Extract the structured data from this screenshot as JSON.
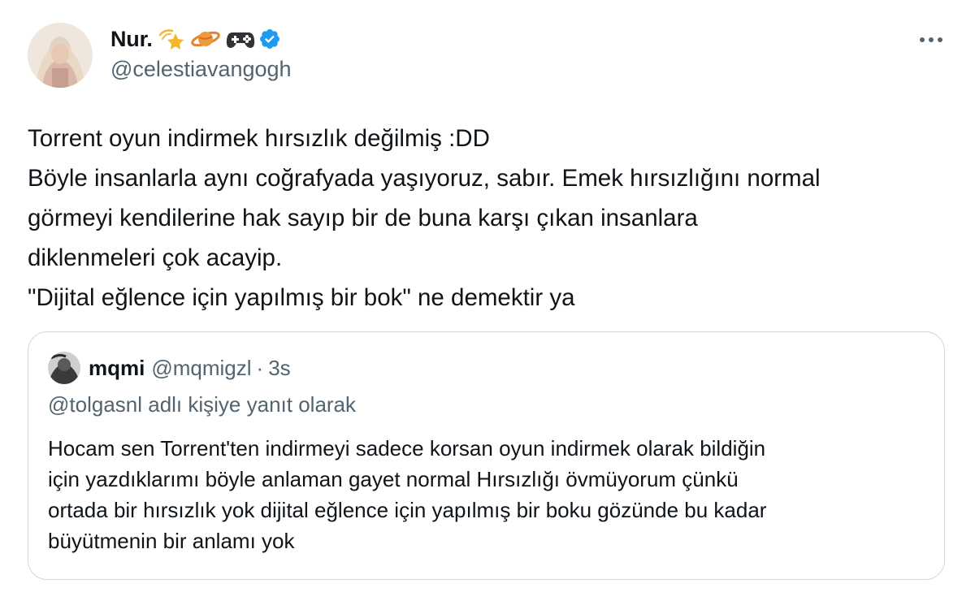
{
  "author": {
    "display_name": "Nur.",
    "handle": "@celestiavangogh",
    "verified": true,
    "name_emojis": [
      "dizzy-star-emoji",
      "ringed-planet-emoji",
      "game-controller-emoji"
    ]
  },
  "more_icon": "more-horizontal-icon",
  "tweet": {
    "lines": [
      "Torrent oyun indirmek hırsızlık değilmiş :DD",
      "Böyle insanlarla aynı coğrafyada yaşıyoruz, sabır. Emek hırsızlığını normal",
      "görmeyi kendilerine hak sayıp bir de buna karşı çıkan insanlara",
      "diklenmeleri çok acayip.",
      "\"Dijital eğlence için yapılmış bir bok\" ne demektir ya"
    ]
  },
  "quote": {
    "display_name": "mqmi",
    "handle": "@mqmigzl",
    "separator": "·",
    "time": "3s",
    "reply_to": "@tolgasnl adlı kişiye yanıt olarak",
    "lines": [
      "Hocam sen Torrent'ten indirmeyi sadece korsan oyun indirmek olarak bildiğin",
      "için yazdıklarımı böyle anlaman gayet normal Hırsızlığı övmüyorum çünkü",
      "ortada bir hırsızlık yok dijital eğlence için yapılmış bir boku gözünde bu kadar",
      "büyütmenin bir anlamı yok"
    ]
  },
  "colors": {
    "text": "#0f1419",
    "secondary": "#536471",
    "border": "#cfd9de",
    "verified": "#1d9bf0"
  }
}
